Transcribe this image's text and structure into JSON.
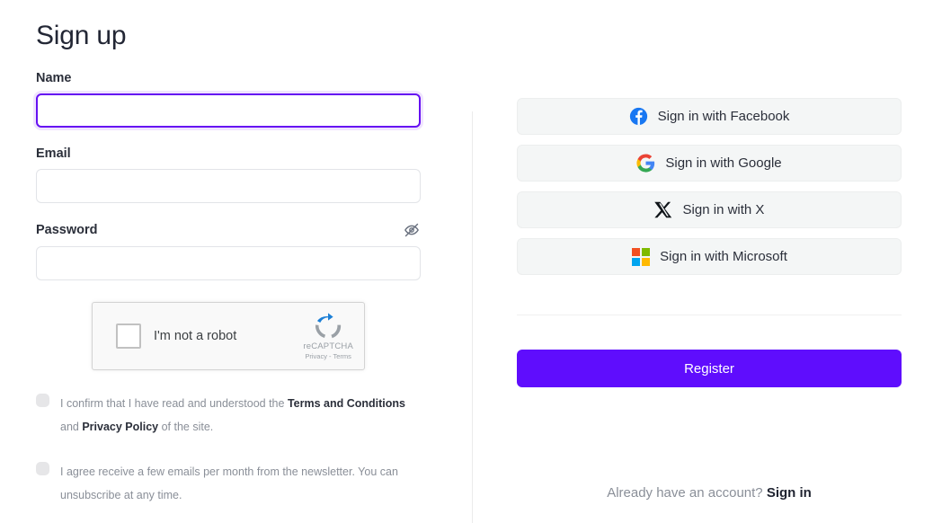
{
  "form": {
    "title": "Sign up",
    "fields": [
      {
        "label": "Name",
        "value": "",
        "placeholder": "",
        "focused": true
      },
      {
        "label": "Email",
        "value": "",
        "placeholder": "",
        "focused": false
      },
      {
        "label": "Password",
        "value": "",
        "placeholder": "",
        "focused": false
      }
    ],
    "password_toggle_icon": "eye-off-icon"
  },
  "recaptcha": {
    "checkbox_label": "I'm not a robot",
    "brand": "reCAPTCHA",
    "links": "Privacy - Terms",
    "logo_icon": "recaptcha-logo-icon",
    "checked": false
  },
  "consents": [
    {
      "checked": false,
      "parts": [
        {
          "text": "I confirm that I have read and understood the ",
          "bold": false
        },
        {
          "text": "Terms and Conditions",
          "bold": true
        },
        {
          "text": " and ",
          "bold": false
        },
        {
          "text": "Privacy Policy",
          "bold": true
        },
        {
          "text": " of the site.",
          "bold": false
        }
      ]
    },
    {
      "checked": false,
      "parts": [
        {
          "text": "I agree receive a few emails per month from the newsletter. You can unsubscribe at any time.",
          "bold": false
        }
      ]
    }
  ],
  "social": {
    "buttons": [
      {
        "label": "Sign in with Facebook",
        "icon": "facebook-icon"
      },
      {
        "label": "Sign in with Google",
        "icon": "google-icon"
      },
      {
        "label": "Sign in with X",
        "icon": "x-icon"
      },
      {
        "label": "Sign in with Microsoft",
        "icon": "microsoft-icon"
      }
    ]
  },
  "actions": {
    "register_label": "Register"
  },
  "footer": {
    "prompt": "Already have an account? ",
    "signin_label": "Sign in"
  },
  "colors": {
    "accent": "#5f0dfd",
    "focus_border": "#6610f2",
    "social_bg": "#f4f6f6",
    "muted_text": "#8a8f98",
    "dark_text": "#2b2f3a",
    "facebook": "#1877f2",
    "google_blue": "#4285f4",
    "google_red": "#ea4335",
    "google_yellow": "#fbbc05",
    "google_green": "#34a853",
    "ms_red": "#f25022",
    "ms_green": "#7fba00",
    "ms_blue": "#00a4ef",
    "ms_yellow": "#ffb900",
    "recaptcha_blue": "#1c7fd6",
    "recaptcha_gray": "#9aa0a6"
  }
}
